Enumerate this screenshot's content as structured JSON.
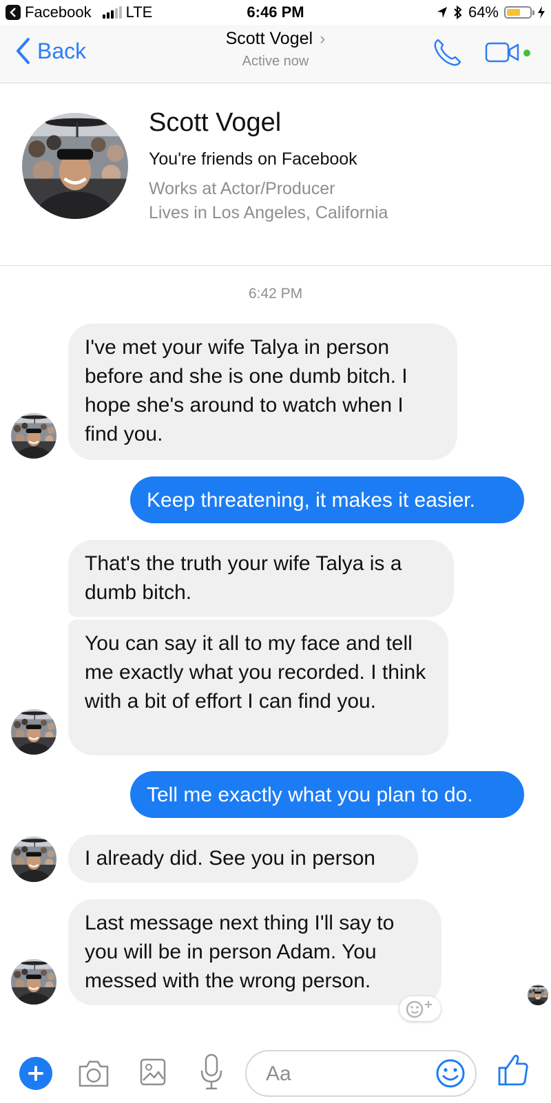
{
  "status_bar": {
    "app": "Facebook",
    "network": "LTE",
    "time": "6:46 PM",
    "battery": "64%",
    "battery_level": 0.64
  },
  "nav": {
    "back_label": "Back",
    "contact_name": "Scott Vogel",
    "status": "Active now"
  },
  "profile": {
    "name": "Scott Vogel",
    "friends": "You're friends on Facebook",
    "works": "Works at Actor/Producer",
    "lives": "Lives in Los Angeles, California"
  },
  "conversation": {
    "timestamp": "6:42 PM",
    "messages": [
      {
        "from": "them",
        "text": "I've met your wife Talya in person before and she is one dumb bitch. I hope she's around to watch when I find you."
      },
      {
        "from": "me",
        "text": "Keep threatening, it makes it easier."
      },
      {
        "from": "them",
        "text": "That's the truth your wife Talya is a dumb bitch."
      },
      {
        "from": "them",
        "text": "You can say it all to my face and tell me exactly what you recorded. I think with a bit of effort I can find you."
      },
      {
        "from": "me",
        "text": "Tell me exactly what you plan to do."
      },
      {
        "from": "them",
        "text": "I already did. See you in person"
      },
      {
        "from": "them",
        "text": "Last message next thing I'll say to you will be in person Adam. You messed with the wrong person."
      }
    ]
  },
  "composer": {
    "placeholder": "Aa"
  },
  "colors": {
    "accent": "#1c7cf4",
    "incoming_bubble": "#f1f0f0",
    "online": "#42c13b"
  },
  "icons": [
    "back-app-icon",
    "location-icon",
    "bluetooth-icon",
    "charging-icon",
    "back-chevron-icon",
    "phone-icon",
    "video-icon",
    "add-icon",
    "camera-icon",
    "gallery-icon",
    "microphone-icon",
    "emoji-icon",
    "like-icon",
    "add-reaction-icon"
  ]
}
